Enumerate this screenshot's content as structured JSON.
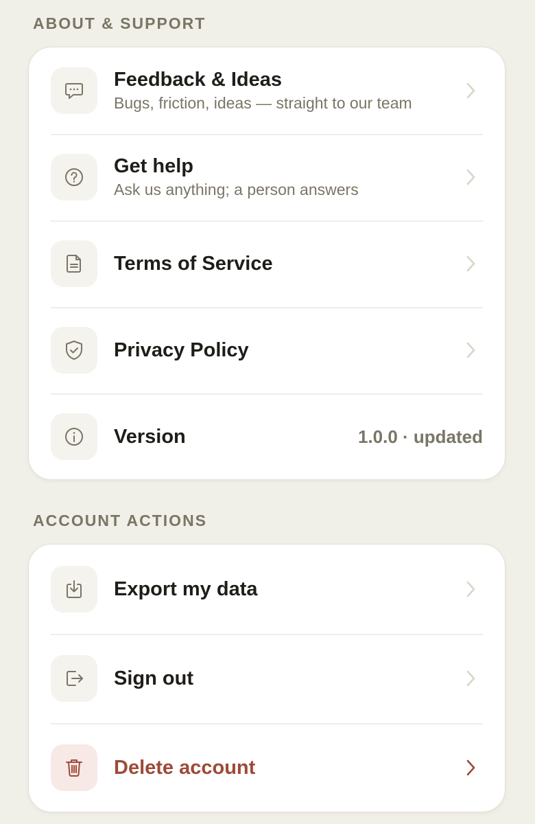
{
  "about": {
    "title": "ABOUT & SUPPORT",
    "items": [
      {
        "label": "Feedback & Ideas",
        "subtitle": "Bugs, friction, ideas — straight to our team",
        "icon": "chat-bubble-icon"
      },
      {
        "label": "Get help",
        "subtitle": "Ask us anything; a person answers",
        "icon": "help-circle-icon"
      },
      {
        "label": "Terms of Service",
        "icon": "document-icon"
      },
      {
        "label": "Privacy Policy",
        "icon": "shield-check-icon"
      },
      {
        "label": "Version",
        "value": "1.0.0 · updated",
        "icon": "info-icon"
      }
    ]
  },
  "account": {
    "title": "ACCOUNT ACTIONS",
    "items": [
      {
        "label": "Export my data",
        "icon": "download-icon"
      },
      {
        "label": "Sign out",
        "icon": "sign-out-icon"
      },
      {
        "label": "Delete account",
        "icon": "trash-icon"
      }
    ]
  },
  "colors": {
    "background": "#f1f0e8",
    "card": "#ffffff",
    "text_primary": "#1f1d18",
    "text_secondary": "#7a7565",
    "icon": "#7a7565",
    "chevron": "#d9d5c8",
    "danger": "#9d4a38",
    "danger_bg": "#f7e9e6"
  }
}
